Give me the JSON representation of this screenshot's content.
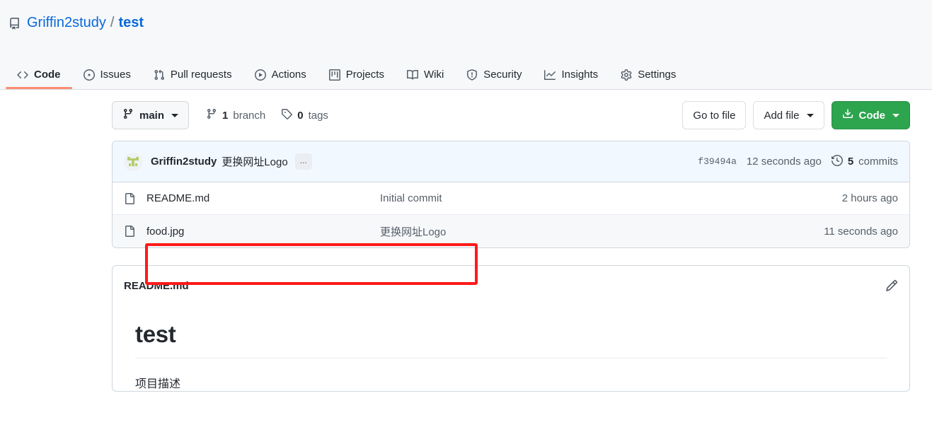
{
  "header": {
    "repo_icon": "repo-icon",
    "owner": "Griffin2study",
    "separator": "/",
    "repo": "test"
  },
  "nav": {
    "tabs": [
      {
        "label": "Code",
        "icon": "code-icon",
        "active": true
      },
      {
        "label": "Issues",
        "icon": "issue-opened-icon",
        "active": false
      },
      {
        "label": "Pull requests",
        "icon": "git-pull-request-icon",
        "active": false
      },
      {
        "label": "Actions",
        "icon": "play-icon",
        "active": false
      },
      {
        "label": "Projects",
        "icon": "project-icon",
        "active": false
      },
      {
        "label": "Wiki",
        "icon": "book-icon",
        "active": false
      },
      {
        "label": "Security",
        "icon": "shield-icon",
        "active": false
      },
      {
        "label": "Insights",
        "icon": "graph-icon",
        "active": false
      },
      {
        "label": "Settings",
        "icon": "gear-icon",
        "active": false
      }
    ]
  },
  "toolbar": {
    "branch_name": "main",
    "branch_icon": "git-branch-icon",
    "branch_count": "1",
    "branch_count_label": "branch",
    "tag_count": "0",
    "tag_count_label": "tags",
    "tag_icon": "tag-icon",
    "go_to_file_label": "Go to file",
    "add_file_label": "Add file",
    "code_label": "Code",
    "code_icon": "download-icon"
  },
  "commit_bar": {
    "avatar": "user-avatar",
    "author": "Griffin2study",
    "message": "更换网址Logo",
    "expand_label": "...",
    "sha": "f39494a",
    "relative_time": "12 seconds ago",
    "history_icon": "history-icon",
    "commits_count": "5",
    "commits_label": "commits"
  },
  "files": {
    "rows": [
      {
        "icon": "file-icon",
        "name": "README.md",
        "commit_message": "Initial commit",
        "age": "2 hours ago",
        "highlighted": false
      },
      {
        "icon": "file-icon",
        "name": "food.jpg",
        "commit_message": "更换网址Logo",
        "age": "11 seconds ago",
        "highlighted": true
      }
    ]
  },
  "readme": {
    "title": "README.md",
    "edit_icon": "pencil-icon",
    "heading": "test",
    "paragraph": "项目描述"
  },
  "colors": {
    "accent_blue": "#0969da",
    "green_button": "#2da44e",
    "active_tab_underline": "#fd8c73",
    "annotation_red": "#ff1a1a",
    "commit_bar_bg": "#f1f8ff",
    "alt_row_bg": "#f6f8fa"
  }
}
